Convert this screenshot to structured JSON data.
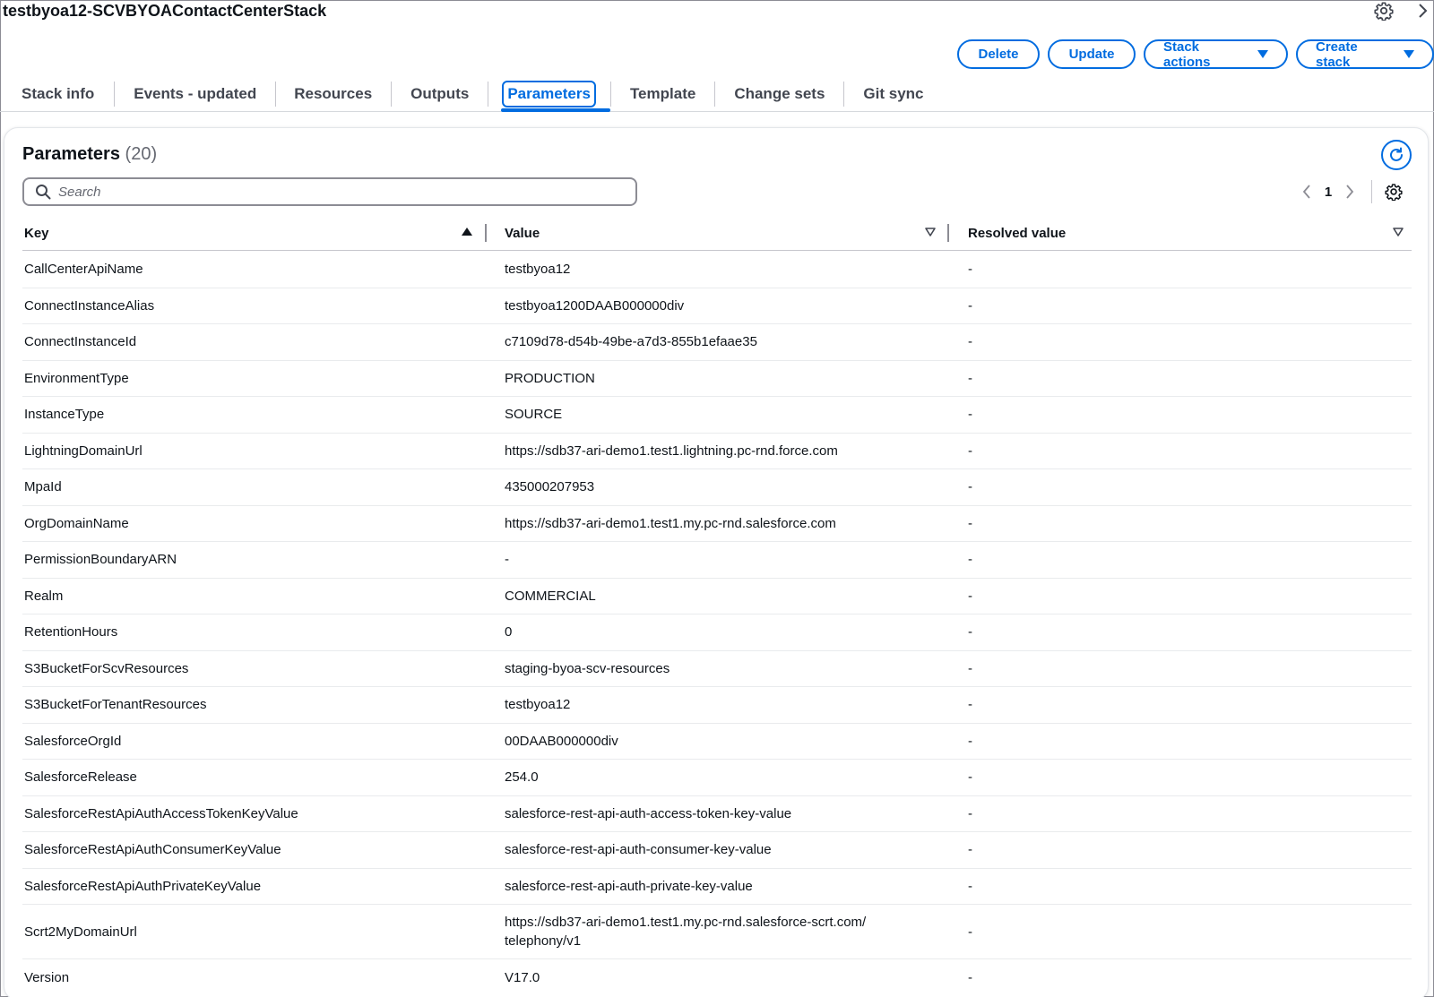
{
  "header": {
    "stack_name": "testbyoa12-SCVBYOAContactCenterStack"
  },
  "actions": {
    "delete_label": "Delete",
    "update_label": "Update",
    "stack_actions_label": "Stack actions",
    "create_stack_label": "Create stack"
  },
  "tabs": [
    {
      "label": "Stack info"
    },
    {
      "label": "Events - updated"
    },
    {
      "label": "Resources"
    },
    {
      "label": "Outputs"
    },
    {
      "label": "Parameters",
      "active": true
    },
    {
      "label": "Template"
    },
    {
      "label": "Change sets"
    },
    {
      "label": "Git sync"
    }
  ],
  "parameters": {
    "title": "Parameters",
    "count": "(20)",
    "search_placeholder": "Search",
    "page": "1",
    "columns": {
      "key": "Key",
      "value": "Value",
      "resolved": "Resolved value"
    },
    "rows": [
      {
        "key": "CallCenterApiName",
        "value": "testbyoa12",
        "resolved": "-"
      },
      {
        "key": "ConnectInstanceAlias",
        "value": "testbyoa1200DAAB000000div",
        "resolved": "-"
      },
      {
        "key": "ConnectInstanceId",
        "value": "c7109d78-d54b-49be-a7d3-855b1efaae35",
        "resolved": "-"
      },
      {
        "key": "EnvironmentType",
        "value": "PRODUCTION",
        "resolved": "-"
      },
      {
        "key": "InstanceType",
        "value": "SOURCE",
        "resolved": "-"
      },
      {
        "key": "LightningDomainUrl",
        "value": "https://sdb37-ari-demo1.test1.lightning.pc-rnd.force.com",
        "resolved": "-"
      },
      {
        "key": "MpaId",
        "value": "435000207953",
        "resolved": "-"
      },
      {
        "key": "OrgDomainName",
        "value": "https://sdb37-ari-demo1.test1.my.pc-rnd.salesforce.com",
        "resolved": "-"
      },
      {
        "key": "PermissionBoundaryARN",
        "value": "-",
        "resolved": "-"
      },
      {
        "key": "Realm",
        "value": "COMMERCIAL",
        "resolved": "-"
      },
      {
        "key": "RetentionHours",
        "value": "0",
        "resolved": "-"
      },
      {
        "key": "S3BucketForScvResources",
        "value": "staging-byoa-scv-resources",
        "resolved": "-"
      },
      {
        "key": "S3BucketForTenantResources",
        "value": "testbyoa12",
        "resolved": "-"
      },
      {
        "key": "SalesforceOrgId",
        "value": "00DAAB000000div",
        "resolved": "-"
      },
      {
        "key": "SalesforceRelease",
        "value": "254.0",
        "resolved": "-"
      },
      {
        "key": "SalesforceRestApiAuthAccessTokenKeyValue",
        "value": "salesforce-rest-api-auth-access-token-key-value",
        "resolved": "-"
      },
      {
        "key": "SalesforceRestApiAuthConsumerKeyValue",
        "value": "salesforce-rest-api-auth-consumer-key-value",
        "resolved": "-"
      },
      {
        "key": "SalesforceRestApiAuthPrivateKeyValue",
        "value": "salesforce-rest-api-auth-private-key-value",
        "resolved": "-"
      },
      {
        "key": "Scrt2MyDomainUrl",
        "value": "https://sdb37-ari-demo1.test1.my.pc-rnd.salesforce-scrt.com/ telephony/v1",
        "resolved": "-"
      },
      {
        "key": "Version",
        "value": "V17.0",
        "resolved": "-"
      }
    ]
  },
  "icons": {
    "settings": "gear-icon",
    "expand": "chevron-right-icon",
    "refresh": "refresh-icon",
    "search": "search-icon",
    "prev": "chevron-left-icon",
    "next": "chevron-right-icon",
    "sort_asc": "sort-ascending-icon",
    "sort": "sort-icon"
  },
  "colors": {
    "accent": "#006ce0",
    "text": "#0f141a",
    "muted": "#656871"
  }
}
